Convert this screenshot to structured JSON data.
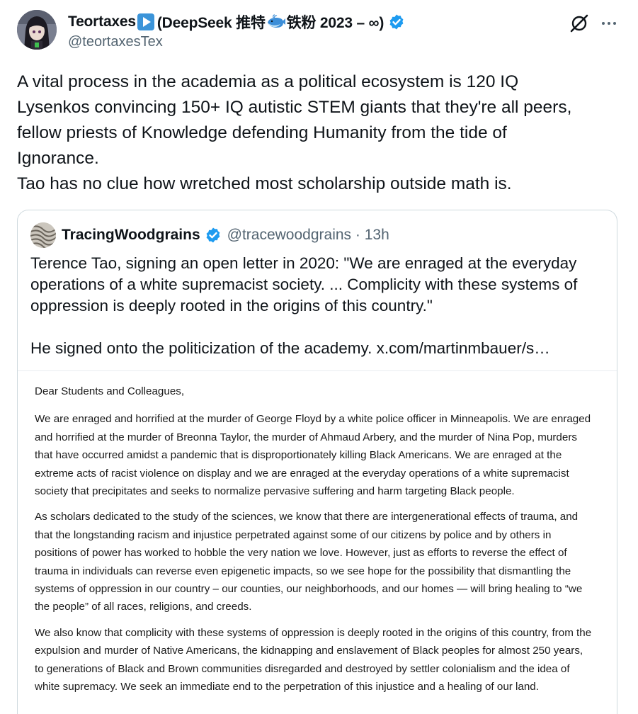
{
  "author": {
    "display_name": "Teortaxes",
    "name_suffix_a": "(DeepSeek 推特",
    "name_suffix_b": "铁粉 2023 – ∞)",
    "handle": "@teortaxesTex"
  },
  "tweet": {
    "lines": [
      "A vital process in the academia as a political ecosystem is 120 IQ",
      "Lysenkos convincing 150+ IQ autistic STEM giants that they're all peers,",
      "fellow priests of Knowledge defending Humanity from the tide of",
      "Ignorance.",
      "Tao has no clue how wretched most scholarship outside math is."
    ]
  },
  "quote": {
    "display_name": "TracingWoodgrains",
    "handle_time": "@tracewoodgrains · 13h",
    "text_lines": [
      "Terence Tao, signing an open letter in 2020: \"We are enraged at the everyday",
      "operations of a white supremacist society. ... Complicity with these systems of",
      "oppression is deeply rooted in the origins of this country.\""
    ],
    "text_line_4": "He signed onto the politicization of the academy.  ",
    "link": "x.com/martinmbauer/s…"
  },
  "letter": {
    "salutation": "Dear Students and Colleagues,",
    "p1": [
      "We are enraged and horrified at the murder of George Floyd by a white police officer in Minneapolis. We are enraged",
      "and horrified at the murder of Breonna Taylor, the murder of Ahmaud Arbery, and the murder of Nina Pop, murders",
      "that have occurred amidst a pandemic that is disproportionately killing Black Americans. We are enraged at the",
      "extreme acts of racist violence on display and we are enraged at the everyday operations of a white supremacist",
      "society that precipitates and seeks to normalize pervasive suffering and harm targeting Black people."
    ],
    "p2": [
      "As scholars dedicated to the study of the sciences, we know that there are intergenerational effects of trauma, and",
      "that the longstanding racism and injustice perpetrated against some of our citizens by police and by others in",
      "positions of power has worked to hobble the very nation we love. However, just as efforts to reverse the effect of",
      "trauma in individuals can reverse even epigenetic impacts, so we see hope for the possibility that dismantling the",
      "systems of oppression in our country – our counties, our neighborhoods, and our homes — will bring healing to “we",
      "the people” of all races, religions, and creeds."
    ],
    "p3": [
      "We also know that complicity with these systems of oppression is deeply rooted in the origins of this country, from the",
      "expulsion and murder of Native Americans, the kidnapping and enslavement of Black peoples for almost 250 years,",
      "to generations of Black and Brown communities disregarded and destroyed by settler colonialism and the idea of",
      "white supremacy. We seek an immediate end to the perpetration of this injustice and a healing of our land."
    ]
  },
  "icons": {
    "verified": "verified-badge-icon",
    "play": "play-button-emoji-icon",
    "whale": "whale-emoji-icon",
    "grok": "grok-icon",
    "more": "more-options-icon"
  },
  "colors": {
    "verified": "#1d9bf0",
    "secondary_text": "#536471",
    "border": "#cfd9de"
  }
}
